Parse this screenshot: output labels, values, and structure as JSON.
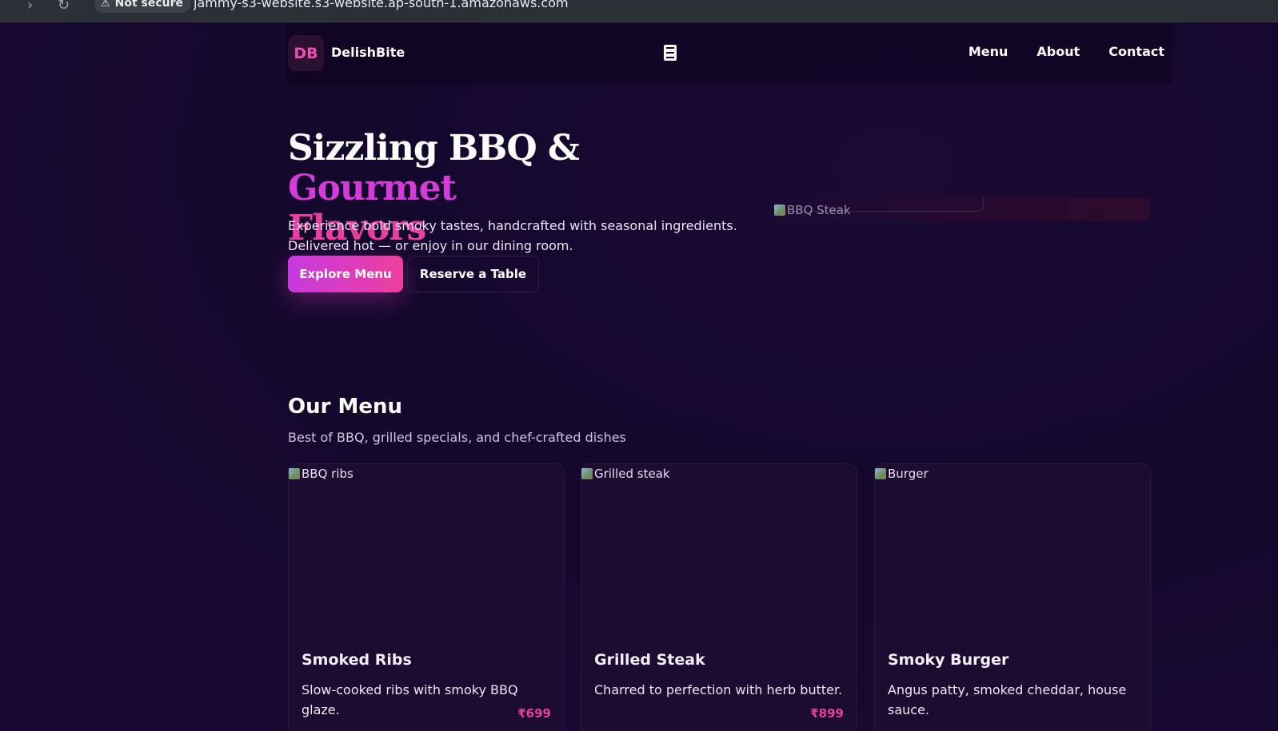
{
  "browser": {
    "security_label": "Not secure",
    "url": "jammy-s3-website.s3-website.ap-south-1.amazonaws.com"
  },
  "header": {
    "logo_initials": "DB",
    "brand": "DelishBite",
    "nav": [
      "Menu",
      "About",
      "Contact"
    ]
  },
  "hero": {
    "title_part1": "Sizzling BBQ",
    "title_amp": "&",
    "title_part2": "Gourmet",
    "title_part3": "Flavors",
    "subtitle_line1": "Experience bold smoky tastes, handcrafted with seasonal ingredients.",
    "subtitle_line2": "Delivered hot — or enjoy in our dining room.",
    "primary_button": "Explore Menu",
    "secondary_button": "Reserve a Table",
    "image_alt": "BBQ Steak"
  },
  "menu": {
    "title": "Our Menu",
    "subtitle": "Best of BBQ, grilled specials, and chef-crafted dishes",
    "items": [
      {
        "image_alt": "BBQ ribs",
        "name": "Smoked Ribs",
        "description": "Slow-cooked ribs with smoky BBQ glaze.",
        "price": "₹699"
      },
      {
        "image_alt": "Grilled steak",
        "name": "Grilled Steak",
        "description": "Charred to perfection with herb butter.",
        "price": "₹899"
      },
      {
        "image_alt": "Burger",
        "name": "Smoky Burger",
        "description": "Angus patty, smoked cheddar, house sauce.",
        "price": ""
      }
    ]
  },
  "colors": {
    "background": "#14082c",
    "accent_purple": "#d63ad8",
    "accent_pink": "#ea3ea4"
  },
  "icons": {
    "warning": "warning-triangle-icon",
    "menu_toggle": "hamburger-icon",
    "broken_image": "broken-image-icon"
  }
}
